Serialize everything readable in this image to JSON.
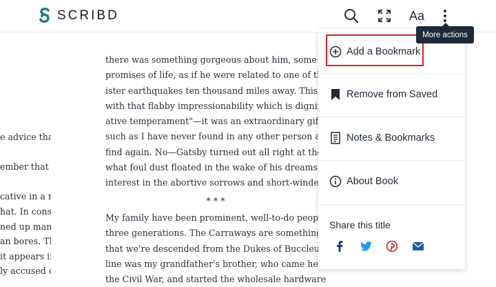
{
  "header": {
    "logo_text": "SCRIBD",
    "font_size_label": "Aa",
    "tooltip": "More actions"
  },
  "reader": {
    "main_lines_top": [
      "there was something gorgeous about him, some hei",
      "promises of life, as if he were related to one of those in",
      "ister earthquakes ten thousand miles away. This respons",
      "with that flabby impressionability which is dignified un",
      "ative temperament\"—it was an extraordinary gift for h",
      "such as I have never found in any other person and whic",
      "find again. No—Gatsby turned out all right at the end; it",
      "what foul dust floated in the wake of his dreams that",
      "interest in the abortive sorrows and short-winded elation"
    ],
    "section_break": "*   *   *",
    "main_lines_bottom": [
      "My family have been prominent, well-to-do people in th",
      "three generations. The Carraways are something of a cla",
      "that we're descended from the Dukes of Buccleuch, bu",
      "line was my grandfather's brother, who came here in fift",
      "the Civil War, and started the wholesale hardware business that my father carries"
    ],
    "left_lines": [
      "e advice that",
      "",
      "ember that all",
      "",
      "cative in a re-",
      "hat. In conse-",
      "ned up many",
      "an bores. The",
      "it appears in",
      "ly accused of"
    ]
  },
  "menu": {
    "items": [
      {
        "label": "Add a Bookmark",
        "icon": "plus-circle-icon"
      },
      {
        "label": "Remove from Saved",
        "icon": "bookmark-filled-icon"
      },
      {
        "label": "Notes & Bookmarks",
        "icon": "document-icon"
      },
      {
        "label": "About Book",
        "icon": "info-circle-icon"
      }
    ],
    "share_title": "Share this title",
    "share_icons": [
      "facebook-icon",
      "twitter-icon",
      "pinterest-icon",
      "email-icon"
    ]
  },
  "colors": {
    "brand": "#1e7b85",
    "text": "#1e2a38",
    "highlight": "#e0201b",
    "share_blue": "#1877c9",
    "share_red": "#d0182b"
  }
}
